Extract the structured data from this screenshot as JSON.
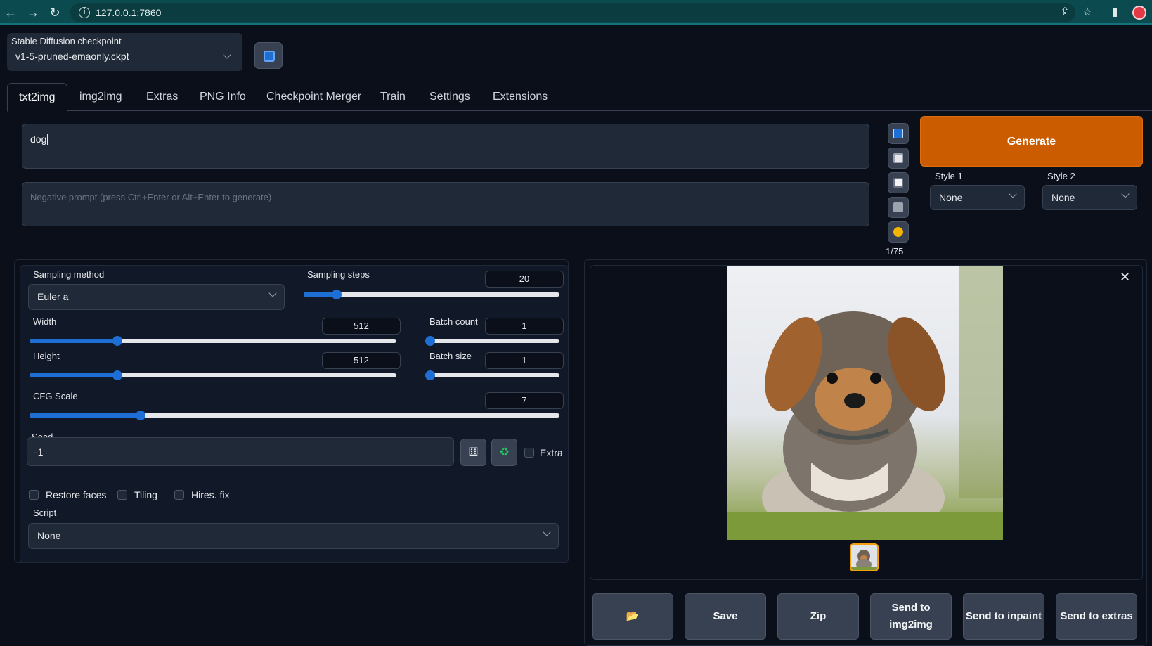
{
  "browser": {
    "url": "127.0.0.1:7860"
  },
  "checkpoint": {
    "label": "Stable Diffusion checkpoint",
    "value": "v1-5-pruned-emaonly.ckpt"
  },
  "tabs": [
    {
      "label": "txt2img",
      "active": true
    },
    {
      "label": "img2img",
      "active": false
    },
    {
      "label": "Extras",
      "active": false
    },
    {
      "label": "PNG Info",
      "active": false
    },
    {
      "label": "Checkpoint Merger",
      "active": false
    },
    {
      "label": "Train",
      "active": false
    },
    {
      "label": "Settings",
      "active": false
    },
    {
      "label": "Extensions",
      "active": false
    }
  ],
  "prompt": {
    "value": "dog",
    "negative_placeholder": "Negative prompt (press Ctrl+Enter or Alt+Enter to generate)",
    "token_counter": "1/75"
  },
  "generate": {
    "label": "Generate",
    "style1_label": "Style 1",
    "style1_value": "None",
    "style2_label": "Style 2",
    "style2_value": "None"
  },
  "settings": {
    "sampling_method_label": "Sampling method",
    "sampling_method_value": "Euler a",
    "sampling_steps_label": "Sampling steps",
    "sampling_steps_value": "20",
    "sampling_steps_fraction": 0.13,
    "width_label": "Width",
    "width_value": "512",
    "width_fraction": 0.24,
    "height_label": "Height",
    "height_value": "512",
    "height_fraction": 0.24,
    "batch_count_label": "Batch count",
    "batch_count_value": "1",
    "batch_count_fraction": 0.0,
    "batch_size_label": "Batch size",
    "batch_size_value": "1",
    "batch_size_fraction": 0.0,
    "cfg_label": "CFG Scale",
    "cfg_value": "7",
    "cfg_fraction": 0.21,
    "seed_label": "Seed",
    "seed_value": "-1",
    "extra_label": "Extra",
    "restore_faces_label": "Restore faces",
    "tiling_label": "Tiling",
    "hires_fix_label": "Hires. fix",
    "script_label": "Script",
    "script_value": "None"
  },
  "actions": {
    "folder_icon": "📂",
    "save_label": "Save",
    "zip_label": "Zip",
    "send_img2img_label": "Send to img2img",
    "send_inpaint_label": "Send to inpaint",
    "send_extras_label": "Send to extras"
  },
  "colors": {
    "accent_orange": "#cc5c00",
    "slider_blue": "#1d6fd6",
    "background": "#0b0f19"
  }
}
